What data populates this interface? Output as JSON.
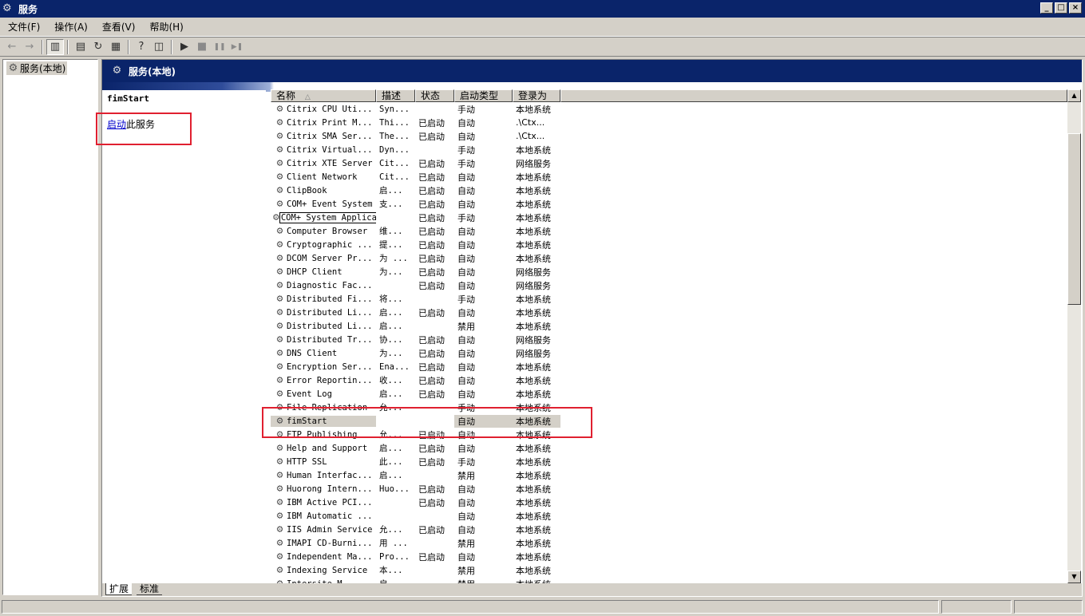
{
  "window": {
    "title": "服务",
    "icon": "gears-icon",
    "buttons": {
      "minimize": "_",
      "maximize": "□",
      "close": "×"
    }
  },
  "menu": [
    {
      "label": "文件(F)"
    },
    {
      "label": "操作(A)"
    },
    {
      "label": "查看(V)"
    },
    {
      "label": "帮助(H)"
    }
  ],
  "toolbar": {
    "back": "←",
    "forward": "→",
    "show_tree": "▥",
    "properties": "▤",
    "refresh": "↻",
    "export": "▦",
    "help": "?",
    "console": "◫",
    "play": "▶",
    "stop": "■",
    "pause": "❚❚",
    "restart": "▶❚"
  },
  "tree": {
    "root_label": "服务(本地)"
  },
  "pane": {
    "header_title": "服务(本地)"
  },
  "description": {
    "service_name": "fimStart",
    "action_link": "启动",
    "action_rest": "此服务"
  },
  "columns": {
    "name": "名称",
    "sort_indicator": "△",
    "description": "描述",
    "status": "状态",
    "startup_type": "启动类型",
    "logon_as": "登录为"
  },
  "services": [
    {
      "name": "Citrix CPU Uti...",
      "desc": "Syn...",
      "status": "",
      "startup": "手动",
      "logon": "本地系统"
    },
    {
      "name": "Citrix Print M...",
      "desc": "Thi...",
      "status": "已启动",
      "startup": "自动",
      "logon": ".\\Ctx..."
    },
    {
      "name": "Citrix SMA Ser...",
      "desc": "The...",
      "status": "已启动",
      "startup": "自动",
      "logon": ".\\Ctx..."
    },
    {
      "name": "Citrix Virtual...",
      "desc": "Dyn...",
      "status": "",
      "startup": "手动",
      "logon": "本地系统"
    },
    {
      "name": "Citrix XTE Server",
      "desc": "Cit...",
      "status": "已启动",
      "startup": "手动",
      "logon": "网络服务"
    },
    {
      "name": "Client Network",
      "desc": "Cit...",
      "status": "已启动",
      "startup": "自动",
      "logon": "本地系统"
    },
    {
      "name": "ClipBook",
      "desc": "启...",
      "status": "已启动",
      "startup": "自动",
      "logon": "本地系统"
    },
    {
      "name": "COM+ Event System",
      "desc": "支...",
      "status": "已启动",
      "startup": "自动",
      "logon": "本地系统"
    },
    {
      "name": "COM+ System Application",
      "desc": "",
      "status": "已启动",
      "startup": "手动",
      "logon": "本地系统"
    },
    {
      "name": "Computer Browser",
      "desc": "维...",
      "status": "已启动",
      "startup": "自动",
      "logon": "本地系统"
    },
    {
      "name": "Cryptographic ...",
      "desc": "提...",
      "status": "已启动",
      "startup": "自动",
      "logon": "本地系统"
    },
    {
      "name": "DCOM Server Pr...",
      "desc": "为 ...",
      "status": "已启动",
      "startup": "自动",
      "logon": "本地系统"
    },
    {
      "name": "DHCP Client",
      "desc": "为...",
      "status": "已启动",
      "startup": "自动",
      "logon": "网络服务"
    },
    {
      "name": "Diagnostic Fac...",
      "desc": "",
      "status": "已启动",
      "startup": "自动",
      "logon": "网络服务"
    },
    {
      "name": "Distributed Fi...",
      "desc": "将...",
      "status": "",
      "startup": "手动",
      "logon": "本地系统"
    },
    {
      "name": "Distributed Li...",
      "desc": "启...",
      "status": "已启动",
      "startup": "自动",
      "logon": "本地系统"
    },
    {
      "name": "Distributed Li...",
      "desc": "启...",
      "status": "",
      "startup": "禁用",
      "logon": "本地系统"
    },
    {
      "name": "Distributed Tr...",
      "desc": "协...",
      "status": "已启动",
      "startup": "自动",
      "logon": "网络服务"
    },
    {
      "name": "DNS Client",
      "desc": "为...",
      "status": "已启动",
      "startup": "自动",
      "logon": "网络服务"
    },
    {
      "name": "Encryption Ser...",
      "desc": "Ena...",
      "status": "已启动",
      "startup": "自动",
      "logon": "本地系统"
    },
    {
      "name": "Error Reportin...",
      "desc": "收...",
      "status": "已启动",
      "startup": "自动",
      "logon": "本地系统"
    },
    {
      "name": "Event Log",
      "desc": "启...",
      "status": "已启动",
      "startup": "自动",
      "logon": "本地系统"
    },
    {
      "name": "File Replication",
      "desc": "允...",
      "status": "",
      "startup": "手动",
      "logon": "本地系统"
    },
    {
      "name": "fimStart",
      "desc": "",
      "status": "",
      "startup": "自动",
      "logon": "本地系统",
      "selected": true
    },
    {
      "name": "FTP Publishing",
      "desc": "允...",
      "status": "已启动",
      "startup": "自动",
      "logon": "本地系统"
    },
    {
      "name": "Help and Support",
      "desc": "启...",
      "status": "已启动",
      "startup": "自动",
      "logon": "本地系统"
    },
    {
      "name": "HTTP SSL",
      "desc": "此...",
      "status": "已启动",
      "startup": "手动",
      "logon": "本地系统"
    },
    {
      "name": "Human Interfac...",
      "desc": "启...",
      "status": "",
      "startup": "禁用",
      "logon": "本地系统"
    },
    {
      "name": "Huorong Intern...",
      "desc": "Huo...",
      "status": "已启动",
      "startup": "自动",
      "logon": "本地系统"
    },
    {
      "name": "IBM Active PCI...",
      "desc": "",
      "status": "已启动",
      "startup": "自动",
      "logon": "本地系统"
    },
    {
      "name": "IBM Automatic ...",
      "desc": "",
      "status": "",
      "startup": "自动",
      "logon": "本地系统"
    },
    {
      "name": "IIS Admin Service",
      "desc": "允...",
      "status": "已启动",
      "startup": "自动",
      "logon": "本地系统"
    },
    {
      "name": "IMAPI CD-Burni...",
      "desc": "用 ...",
      "status": "",
      "startup": "禁用",
      "logon": "本地系统"
    },
    {
      "name": "Independent Ma...",
      "desc": "Pro...",
      "status": "已启动",
      "startup": "自动",
      "logon": "本地系统"
    },
    {
      "name": "Indexing Service",
      "desc": "本...",
      "status": "",
      "startup": "禁用",
      "logon": "本地系统"
    },
    {
      "name": "Intersite M...",
      "desc": "启...",
      "status": "",
      "startup": "禁用",
      "logon": "本地系统"
    }
  ],
  "tabs": [
    {
      "label": "扩展"
    },
    {
      "label": "标准"
    }
  ],
  "colors": {
    "title_bar": "#0a246a",
    "annotation": "#e02030"
  }
}
